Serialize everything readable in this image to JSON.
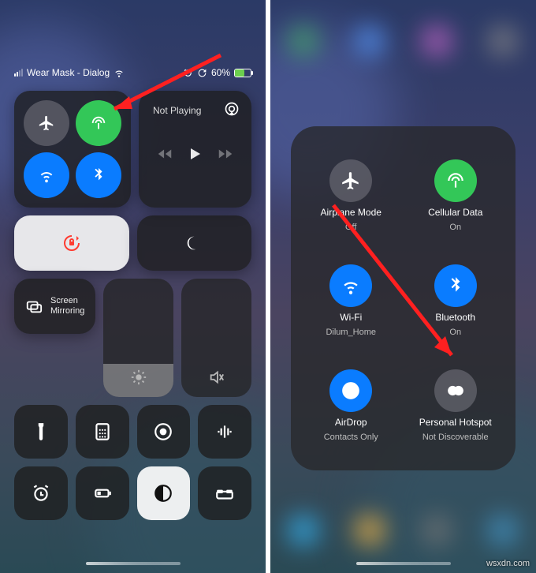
{
  "status": {
    "carrier": "Wear Mask - Dialog",
    "battery_pct": "60%",
    "battery_fill_pct": 60
  },
  "left": {
    "media": {
      "title": "Not Playing"
    },
    "screen_mirroring_line1": "Screen",
    "screen_mirroring_line2": "Mirroring"
  },
  "right": {
    "airplane": {
      "label": "Airplane Mode",
      "sub": "Off"
    },
    "cellular": {
      "label": "Cellular Data",
      "sub": "On"
    },
    "wifi": {
      "label": "Wi-Fi",
      "sub": "Dilum_Home"
    },
    "bluetooth": {
      "label": "Bluetooth",
      "sub": "On"
    },
    "airdrop": {
      "label": "AirDrop",
      "sub": "Contacts Only"
    },
    "hotspot": {
      "label": "Personal Hotspot",
      "sub": "Not Discoverable"
    }
  },
  "watermark": "wsxdn.com"
}
